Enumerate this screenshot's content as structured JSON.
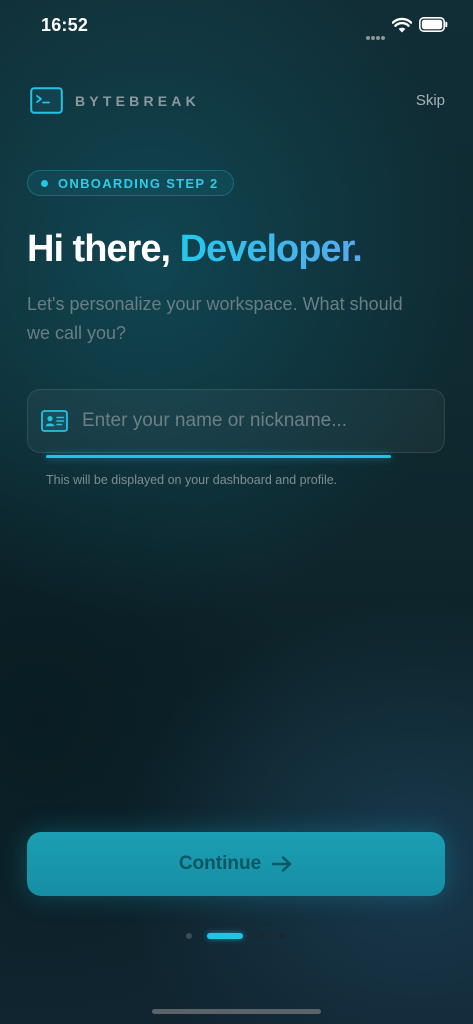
{
  "status_bar": {
    "time": "16:52"
  },
  "header": {
    "brand": "BYTEBREAK",
    "skip_label": "Skip",
    "logo_icon": "terminal-icon"
  },
  "badge": {
    "label": "ONBOARDING STEP 2"
  },
  "headline": {
    "greeting": "Hi there, ",
    "name": "Developer."
  },
  "subtitle": "Let's personalize your workspace. What should we call you?",
  "name_field": {
    "icon": "id-card-icon",
    "value": "",
    "placeholder": "Enter your name or nickname...",
    "helper": "This will be displayed on your dashboard and profile."
  },
  "continue_button": {
    "label": "Continue",
    "icon": "arrow-right-icon"
  },
  "pagination": {
    "current_page": 2,
    "total_pages": 4
  },
  "colors": {
    "accent": "#22c4e6",
    "button": "#1897ab",
    "background": "#0f2a31"
  }
}
